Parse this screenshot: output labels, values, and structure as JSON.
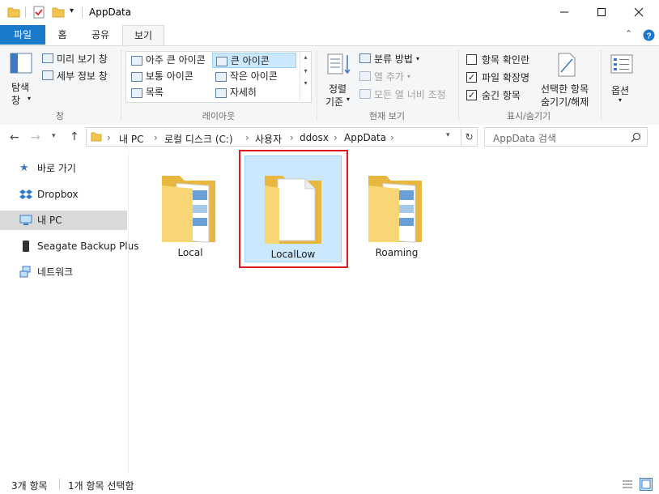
{
  "window": {
    "title": "AppData",
    "qat_icons": [
      "folder-icon",
      "properties-icon",
      "new-folder-icon",
      "qat-dropdown-icon"
    ],
    "controls": [
      "minimize",
      "maximize",
      "close"
    ]
  },
  "tabs": [
    {
      "label": "파일"
    },
    {
      "label": "홈"
    },
    {
      "label": "공유"
    },
    {
      "label": "보기"
    }
  ],
  "ribbon": {
    "pane": {
      "nav_pane_label_1": "탐색",
      "nav_pane_label_2": "창",
      "preview_label": "미리 보기 창",
      "details_label": "세부 정보 창",
      "group_label": "창"
    },
    "layout": {
      "items": [
        "아주 큰 아이콘",
        "큰 아이콘",
        "보통 아이콘",
        "작은 아이콘",
        "목록",
        "자세히"
      ],
      "selected": "큰 아이콘",
      "group_label": "레이아웃"
    },
    "current_view": {
      "sort_label_1": "정렬",
      "sort_label_2": "기준",
      "group_by_label": "분류 방법",
      "add_column_label": "열 추가",
      "fit_columns_label": "모든 열 너비 조정",
      "group_label": "현재 보기"
    },
    "show_hide": {
      "item_checkboxes_label": "항목 확인란",
      "file_ext_label": "파일 확장명",
      "hidden_items_label": "숨긴 항목",
      "hide_selected_label_1": "선택한 항목",
      "hide_selected_label_2": "숨기기/해제",
      "group_label": "표시/숨기기",
      "item_checkboxes_checked": false,
      "file_ext_checked": true,
      "hidden_items_checked": true
    },
    "options": {
      "label": "옵션"
    }
  },
  "address": {
    "crumbs": [
      "내 PC",
      "로컬 디스크 (C:)",
      "사용자",
      "ddosx",
      "AppData"
    ],
    "search_placeholder": "AppData 검색"
  },
  "nav_pane": {
    "items": [
      {
        "label": "바로 가기",
        "icon": "star-icon"
      },
      {
        "label": "Dropbox",
        "icon": "dropbox-icon"
      },
      {
        "label": "내 PC",
        "icon": "pc-icon",
        "selected": true
      },
      {
        "label": "Seagate Backup Plus",
        "icon": "drive-icon"
      },
      {
        "label": "네트워크",
        "icon": "network-icon"
      }
    ]
  },
  "folders": [
    {
      "name": "Local",
      "selected": false
    },
    {
      "name": "LocalLow",
      "selected": true
    },
    {
      "name": "Roaming",
      "selected": false
    }
  ],
  "status": {
    "count": "3개 항목",
    "selection": "1개 항목 선택함"
  },
  "colors": {
    "file_tab": "#1979ca",
    "selection": "#cce8ff",
    "highlight_box": "#e0191e"
  }
}
